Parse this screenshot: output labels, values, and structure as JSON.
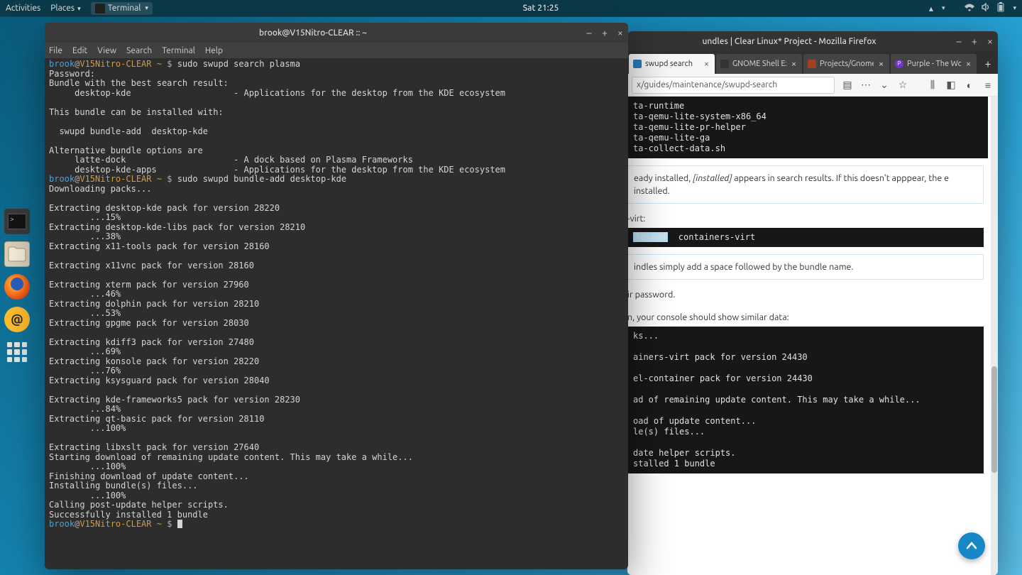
{
  "topbar": {
    "activities": "Activities",
    "places": "Places",
    "terminal": "Terminal",
    "clock": "Sat 21:25"
  },
  "dock": {
    "items": [
      "terminal",
      "files",
      "firefox",
      "email",
      "apps-grid"
    ]
  },
  "terminal": {
    "title": "brook@V15Nitro-CLEAR :: ~",
    "menus": [
      "File",
      "Edit",
      "View",
      "Search",
      "Terminal",
      "Help"
    ],
    "prompt": {
      "user": "brook",
      "host": "V15Nitro-CLEAR",
      "path": "~",
      "sym": "$"
    },
    "cmd1": "sudo swupd search plasma",
    "cmd2": "sudo swupd bundle-add desktop-kde",
    "lines": [
      "Password:",
      "Bundle with the best search result:",
      "     desktop-kde                    - Applications for the desktop from the KDE ecosystem",
      "",
      "This bundle can be installed with:",
      "",
      "  swupd bundle-add  desktop-kde",
      "",
      "Alternative bundle options are",
      "     latte-dock                     - A dock based on Plasma Frameworks",
      "     desktop-kde-apps               - Applications for the desktop from the KDE ecosystem"
    ],
    "lines2": [
      "Downloading packs...",
      "",
      "Extracting desktop-kde pack for version 28220",
      "        ...15%",
      "Extracting desktop-kde-libs pack for version 28210",
      "        ...38%",
      "Extracting x11-tools pack for version 28160",
      "",
      "Extracting x11vnc pack for version 28160",
      "",
      "Extracting xterm pack for version 27960",
      "        ...46%",
      "Extracting dolphin pack for version 28210",
      "        ...53%",
      "Extracting gpgme pack for version 28030",
      "",
      "Extracting kdiff3 pack for version 27480",
      "        ...69%",
      "Extracting konsole pack for version 28220",
      "        ...76%",
      "Extracting ksysguard pack for version 28040",
      "",
      "Extracting kde-frameworks5 pack for version 28230",
      "        ...84%",
      "Extracting qt-basic pack for version 28110",
      "        ...100%",
      "",
      "Extracting libxslt pack for version 27640",
      "Starting download of remaining update content. This may take a while...",
      "        ...100%",
      "Finishing download of update content...",
      "Installing bundle(s) files...",
      "        ...100%",
      "Calling post-update helper scripts.",
      "Successfully installed 1 bundle"
    ]
  },
  "firefox": {
    "title": "undles | Clear Linux* Project - Mozilla Firefox",
    "tabs": [
      {
        "label": "swupd search",
        "active": true
      },
      {
        "label": "GNOME Shell Exten",
        "active": false
      },
      {
        "label": "Projects/GnomeSh",
        "active": false
      },
      {
        "label": "Purple - The Worl",
        "active": false
      }
    ],
    "url": "x/guides/maintenance/swupd-search",
    "code1": "ta-runtime\nta-qemu-lite-system-x86_64\nta-qemu-lite-pr-helper\nta-qemu-lite-ga\nta-collect-data.sh",
    "note1a": "eady installed, ",
    "note1b": "[installed]",
    "note1c": " appears in search results. If this doesn't apppear, the e installed.",
    "virtline": "-virt:",
    "code2a": "le-add",
    "code2b": "  containers-virt",
    "note2": "indles simply add a space followed by the bundle name.",
    "pw": "ir password.",
    "console": "n, your console should show similar data:",
    "code3": "ks...\n\nainers-virt pack for version 24430\n\nel-container pack for version 24430\n\nad of remaining update content. This may take a while...\n\noad of update content...\nle(s) files...\n\ndate helper scripts.\nstalled 1 bundle"
  }
}
